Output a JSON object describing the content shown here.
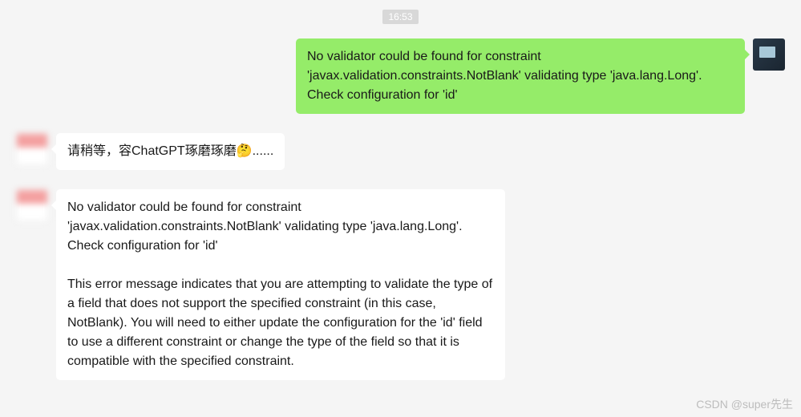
{
  "timestamp": "16:53",
  "messages": {
    "sent1": "No validator could be found for constraint 'javax.validation.constraints.NotBlank' validating type 'java.lang.Long'. Check configuration for 'id'",
    "recv1": "请稍等，容ChatGPT琢磨琢磨🤔......",
    "recv2_part1": "No validator could be found for constraint 'javax.validation.constraints.NotBlank' validating type 'java.lang.Long'. Check configuration for 'id'",
    "recv2_part2": "This error message indicates that you are attempting to validate the type of a field that does not support the specified constraint (in this case, NotBlank). You will need to either update the configuration for the 'id' field to use a different constraint or change the type of the field so that it is compatible with the specified constraint."
  },
  "watermark": "CSDN @super先生",
  "colors": {
    "sent_bubble": "#95ec69",
    "recv_bubble": "#ffffff",
    "background": "#f5f5f5",
    "timestamp_bg": "#d8d8d8"
  }
}
